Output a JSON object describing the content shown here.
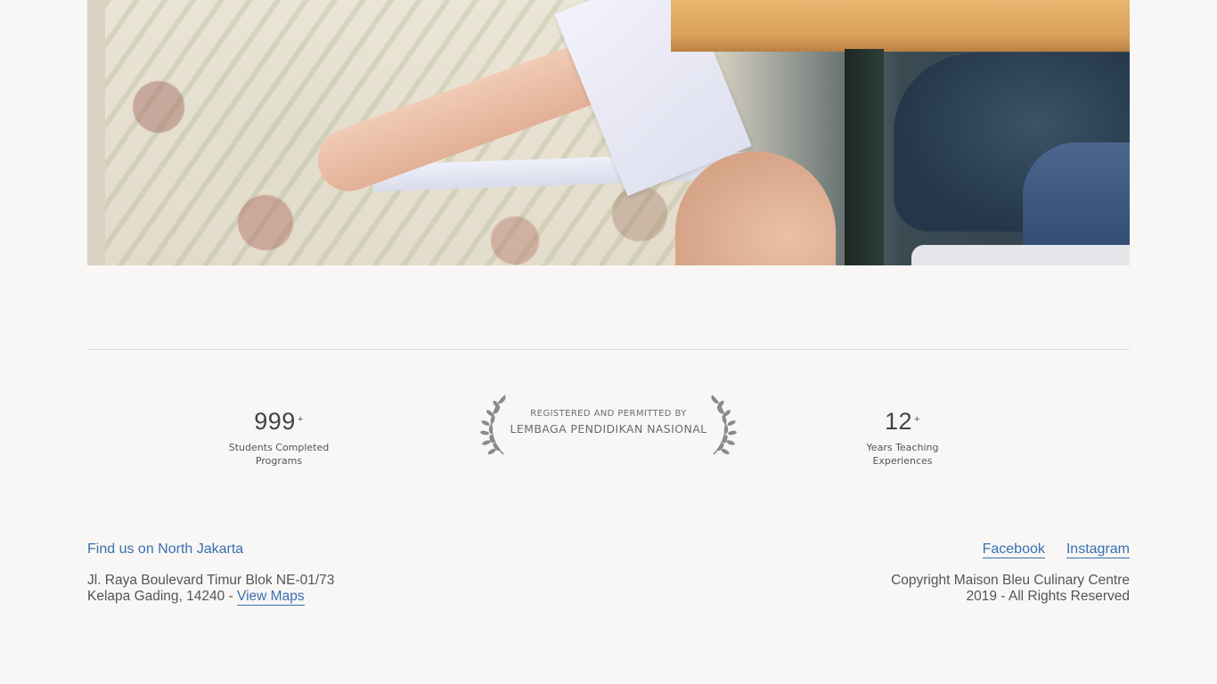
{
  "hero": {
    "image_alt": "Student reading class documents"
  },
  "stats": {
    "students": {
      "number": "999",
      "suffix": "+",
      "caption_line1": "Students Completed",
      "caption_line2": "Programs"
    },
    "years": {
      "number": "12",
      "suffix": "+",
      "caption_line1": "Years Teaching",
      "caption_line2": "Experiences"
    }
  },
  "badge": {
    "line1": "REGISTERED AND PERMITTED BY",
    "line2": "LEMBAGA PENDIDIKAN NASIONAL",
    "icon": "laurel-wreath-icon"
  },
  "footer": {
    "find_us": "Find us on North Jakarta",
    "address_line1": "Jl. Raya Boulevard Timur Blok NE-01/73",
    "address_line2": "Kelapa Gading, 14240 - ",
    "view_maps": "View Maps",
    "social": {
      "facebook": "Facebook",
      "instagram": "Instagram"
    },
    "copyright_line1": "Copyright Maison Bleu Culinary Centre",
    "copyright_line2": "2019 - All Rights Reserved"
  },
  "colors": {
    "background": "#f8f7f5",
    "link": "#3a6fb0",
    "text": "#555555"
  }
}
